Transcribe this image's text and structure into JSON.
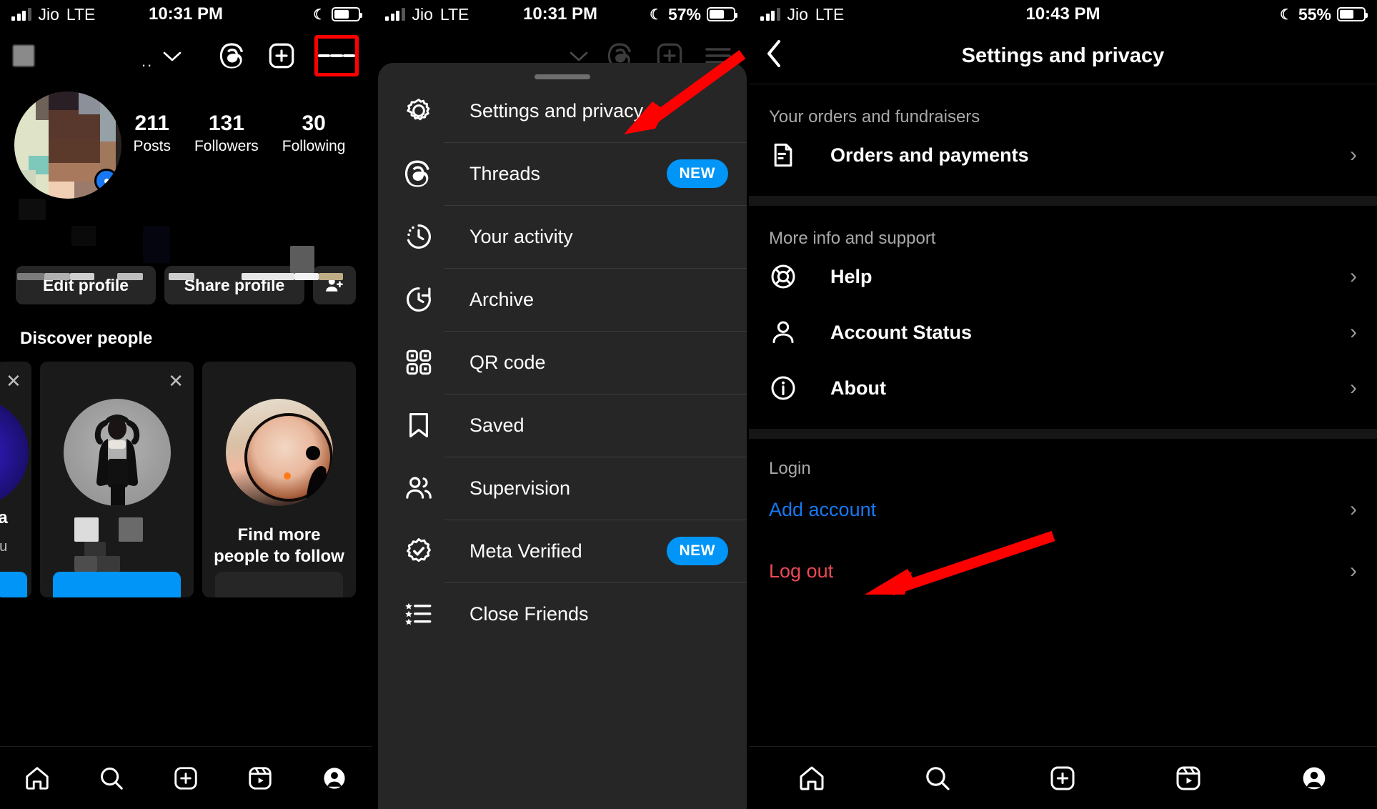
{
  "status_bars": [
    {
      "carrier": "Jio",
      "network": "LTE",
      "time": "10:31 PM",
      "battery": "57%",
      "moon": "☾"
    },
    {
      "carrier": "Jio",
      "network": "LTE",
      "time": "10:31 PM",
      "battery": "57%",
      "moon": "☾"
    },
    {
      "carrier": "Jio",
      "network": "LTE",
      "time": "10:43 PM",
      "battery": "55%",
      "moon": "☾"
    }
  ],
  "colors": {
    "accent_blue": "#0095F6",
    "link_blue": "#1877F2",
    "danger_red": "#ED4956",
    "annotation_red": "#FF0000",
    "sheet_bg": "#262626",
    "page_bg": "#000000"
  },
  "panel1": {
    "name": "profile-screen",
    "topbar": {
      "username_dots": "..",
      "chevron": "⌄",
      "threads_icon": "threads-icon",
      "new_post_icon": "plus-square-icon",
      "menu_icon": "hamburger-menu-icon",
      "menu_highlighted": true
    },
    "stats": [
      {
        "num": "211",
        "label": "Posts"
      },
      {
        "num": "131",
        "label": "Followers"
      },
      {
        "num": "30",
        "label": "Following"
      }
    ],
    "buttons": {
      "edit_profile": "Edit profile",
      "share_profile": "Share profile",
      "add_people_icon": "add-person-icon"
    },
    "discover": {
      "title": "Discover people",
      "cards": [
        {
          "name": "ya",
          "subtitle": "you",
          "cta": "",
          "close": "✕"
        },
        {
          "name": "",
          "subtitle": "",
          "cta": "",
          "close": "✕"
        },
        {
          "name": "Find more",
          "subtitle": "people to follow",
          "cta": "",
          "close": ""
        }
      ]
    },
    "bottom_nav": [
      "home-icon",
      "search-icon",
      "create-icon",
      "reels-icon",
      "profile-icon"
    ]
  },
  "panel2": {
    "name": "menu-sheet-screen",
    "items": [
      {
        "icon": "gear-icon",
        "label": "Settings and privacy",
        "badge": ""
      },
      {
        "icon": "threads-icon",
        "label": "Threads",
        "badge": "NEW"
      },
      {
        "icon": "activity-icon",
        "label": "Your activity",
        "badge": ""
      },
      {
        "icon": "archive-icon",
        "label": "Archive",
        "badge": ""
      },
      {
        "icon": "qr-code-icon",
        "label": "QR code",
        "badge": ""
      },
      {
        "icon": "bookmark-icon",
        "label": "Saved",
        "badge": ""
      },
      {
        "icon": "supervision-icon",
        "label": "Supervision",
        "badge": ""
      },
      {
        "icon": "verified-icon",
        "label": "Meta Verified",
        "badge": "NEW"
      },
      {
        "icon": "close-friends-icon",
        "label": "Close Friends",
        "badge": ""
      }
    ],
    "annotation_arrow_target": "Settings and privacy"
  },
  "panel3": {
    "name": "settings-and-privacy-screen",
    "header": {
      "back_icon": "chevron-left-icon",
      "title": "Settings and privacy"
    },
    "sections": [
      {
        "title": "Your orders and fundraisers",
        "rows": [
          {
            "icon": "receipt-icon",
            "label": "Orders and payments",
            "chevron": "›",
            "style": "normal"
          }
        ]
      },
      {
        "title": "More info and support",
        "rows": [
          {
            "icon": "help-icon",
            "label": "Help",
            "chevron": "›",
            "style": "normal"
          },
          {
            "icon": "person-icon",
            "label": "Account Status",
            "chevron": "›",
            "style": "normal"
          },
          {
            "icon": "info-icon",
            "label": "About",
            "chevron": "›",
            "style": "normal"
          }
        ]
      },
      {
        "title": "Login",
        "rows": [
          {
            "icon": "",
            "label": "Add account",
            "chevron": "›",
            "style": "blue"
          },
          {
            "icon": "",
            "label": "Log out",
            "chevron": "›",
            "style": "red"
          }
        ]
      }
    ],
    "bottom_nav": [
      "home-icon",
      "search-icon",
      "create-icon",
      "reels-icon",
      "profile-icon"
    ],
    "annotation_arrow_target": "Log out"
  }
}
